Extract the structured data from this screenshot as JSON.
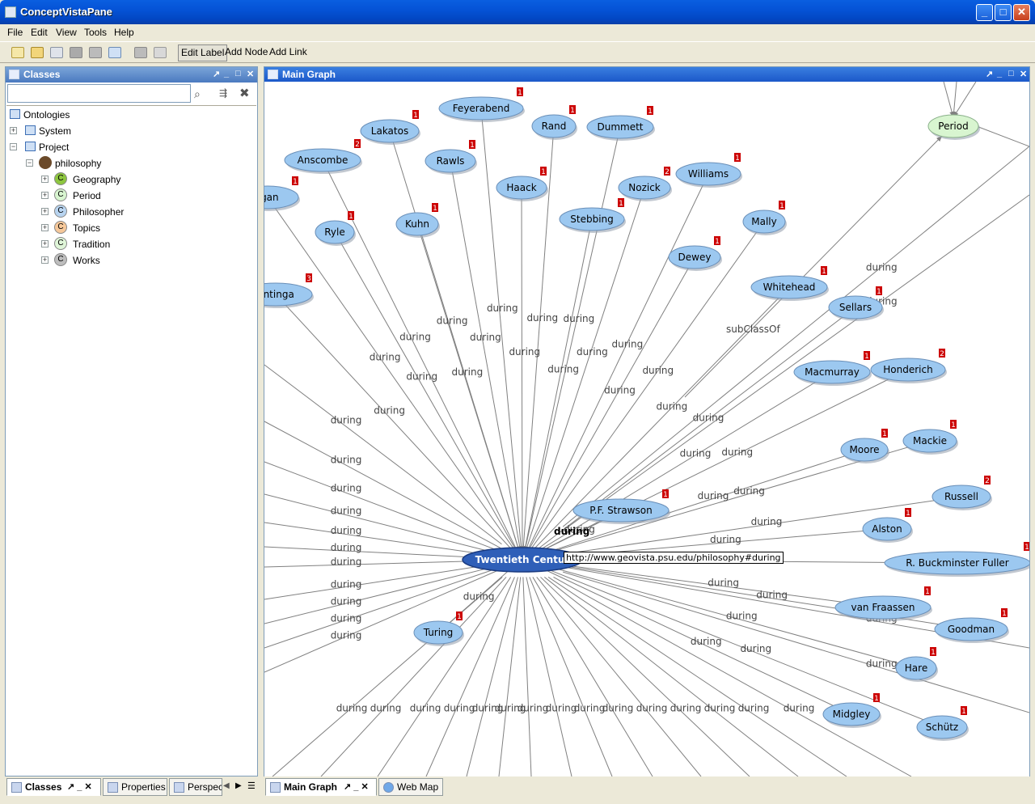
{
  "window": {
    "title": "ConceptVistaPane",
    "min": "_",
    "max": "□",
    "close": "✕"
  },
  "menu": [
    "File",
    "Edit",
    "View",
    "Tools",
    "Help"
  ],
  "toolbar": {
    "edit_label": "Edit Label",
    "add_node": "Add Node",
    "add_link": "Add Link"
  },
  "classes_panel": {
    "title": "Classes",
    "search_value": "",
    "tree": [
      {
        "label": "Ontologies",
        "level": 0,
        "icon": "monitor-icon"
      },
      {
        "label": "System",
        "level": 1,
        "icon": "monitor-icon",
        "expander": "+"
      },
      {
        "label": "Project",
        "level": 1,
        "icon": "monitor-icon",
        "expander": "−"
      },
      {
        "label": "philosophy",
        "level": 2,
        "icon": "owl-icon",
        "expander": "−"
      },
      {
        "label": "Geography",
        "level": 3,
        "icon": "class-icon",
        "color": "#8dc63f",
        "expander": "+"
      },
      {
        "label": "Period",
        "level": 3,
        "icon": "class-icon",
        "color": "#d8f5d0",
        "expander": "+"
      },
      {
        "label": "Philosopher",
        "level": 3,
        "icon": "class-icon",
        "color": "#b8d4f0",
        "expander": "+"
      },
      {
        "label": "Topics",
        "level": 3,
        "icon": "class-icon",
        "color": "#f6c89a",
        "expander": "+"
      },
      {
        "label": "Tradition",
        "level": 3,
        "icon": "class-icon",
        "color": "#dff5d8",
        "expander": "+"
      },
      {
        "label": "Works",
        "level": 3,
        "icon": "class-icon",
        "color": "#bdbdbd",
        "expander": "+"
      }
    ],
    "class_icon_letter": "C"
  },
  "left_tabs": [
    "Classes",
    "Properties",
    "Perspec"
  ],
  "main_panel": {
    "title": "Main Graph"
  },
  "bottom_tabs": [
    "Main Graph",
    "Web Map"
  ],
  "graph": {
    "center": {
      "label": "Twentieth Century",
      "shown": "Twentieth Centur"
    },
    "edge_label": "during",
    "hover_label": "during",
    "tooltip": "http://www.geovista.psu.edu/philosophy#during",
    "subclass_label": "subClassOf",
    "period_node": "Period",
    "nodes": [
      {
        "label": "Feyerabend",
        "badge": "1"
      },
      {
        "label": "Rand",
        "badge": "1"
      },
      {
        "label": "Dummett",
        "badge": "1"
      },
      {
        "label": "Lakatos",
        "badge": "1"
      },
      {
        "label": "Anscombe",
        "badge": "2"
      },
      {
        "label": "Rawls",
        "badge": "1"
      },
      {
        "label": "Haack",
        "badge": "1"
      },
      {
        "label": "Nozick",
        "badge": "2"
      },
      {
        "label": "Williams",
        "badge": "1"
      },
      {
        "label": "rgan",
        "badge": "1"
      },
      {
        "label": "Ryle",
        "badge": "1"
      },
      {
        "label": "Kuhn",
        "badge": "1"
      },
      {
        "label": "Stebbing",
        "badge": "1"
      },
      {
        "label": "Mally",
        "badge": "1"
      },
      {
        "label": "Dewey",
        "badge": "1"
      },
      {
        "label": "antinga",
        "badge": "3"
      },
      {
        "label": "Whitehead",
        "badge": "1"
      },
      {
        "label": "Sellars",
        "badge": "1"
      },
      {
        "label": "Macmurray",
        "badge": "1"
      },
      {
        "label": "Honderich",
        "badge": "2"
      },
      {
        "label": "Moore",
        "badge": "1"
      },
      {
        "label": "Mackie",
        "badge": "1"
      },
      {
        "label": "Russell",
        "badge": "2"
      },
      {
        "label": "P.F. Strawson",
        "badge": "1"
      },
      {
        "label": "Alston",
        "badge": "1"
      },
      {
        "label": "R. Buckminster Fuller",
        "badge": "1"
      },
      {
        "label": "van Fraassen",
        "badge": "1"
      },
      {
        "label": "Goodman",
        "badge": "1"
      },
      {
        "label": "Turing",
        "badge": "1"
      },
      {
        "label": "Hare",
        "badge": "1"
      },
      {
        "label": "Midgley",
        "badge": "1"
      },
      {
        "label": "Schütz",
        "badge": "1"
      }
    ]
  },
  "colors": {
    "node_fill": "#9cc8f0",
    "node_stroke": "#6a8fb8",
    "center_fill": "#2f5fb8",
    "period_fill": "#d8f5d0",
    "badge": "#cc0000",
    "edge": "#808080"
  }
}
